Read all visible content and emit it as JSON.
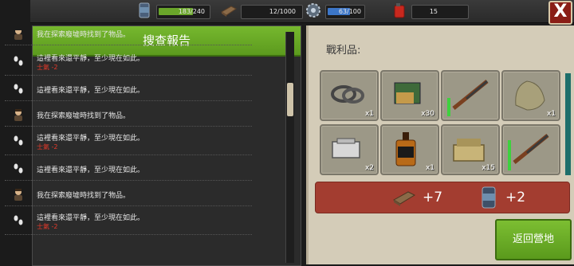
{
  "top_bar": {
    "food": {
      "text": "183/240",
      "fill": 0.76,
      "color": "#6aa62a",
      "icon": "canned-food-icon"
    },
    "materials": {
      "text": "12/1000",
      "icon": "wood-plank-icon"
    },
    "water": {
      "text": "63/100",
      "fill": 0.63,
      "color": "#3c76c8",
      "icon": "water-gear-icon"
    },
    "fuel": {
      "text": "15",
      "icon": "fuel-can-icon"
    },
    "close_label": "X"
  },
  "report": {
    "title": "搜查報告",
    "entries": [
      {
        "icon": "survivor-icon",
        "text": "我在探索廢墟時找到了物品。",
        "morale": ""
      },
      {
        "icon": "footprints-icon",
        "text": "這裡看來還平靜，至少現在如此。",
        "morale": "士氣 -2"
      },
      {
        "icon": "footprints-icon",
        "text": "這裡看來還平靜，至少現在如此。",
        "morale": ""
      },
      {
        "icon": "survivor-icon",
        "text": "我在探索廢墟時找到了物品。",
        "morale": ""
      },
      {
        "icon": "footprints-icon",
        "text": "這裡看來還平靜，至少現在如此。",
        "morale": "士氣 -2"
      },
      {
        "icon": "footprints-icon",
        "text": "這裡看來還平靜，至少現在如此。",
        "morale": ""
      },
      {
        "icon": "survivor-icon",
        "text": "我在探索廢墟時找到了物品。",
        "morale": ""
      },
      {
        "icon": "footprints-icon",
        "text": "這裡看來還平靜，至少現在如此。",
        "morale": "士氣 -2"
      }
    ]
  },
  "loot": {
    "title": "戰利品:",
    "items": [
      {
        "icon": "rope-icon",
        "qty": "x1",
        "condition": null
      },
      {
        "icon": "ammo-box-icon",
        "qty": "x30",
        "condition": null
      },
      {
        "icon": "rifle-icon",
        "qty": "",
        "condition": 0.45
      },
      {
        "icon": "cloth-sack-icon",
        "qty": "x1",
        "condition": null
      },
      {
        "icon": "toolbox-icon",
        "qty": "x2",
        "condition": null
      },
      {
        "icon": "whiskey-bottle-icon",
        "qty": "x1",
        "condition": null
      },
      {
        "icon": "bullets-crate-icon",
        "qty": "x15",
        "condition": null
      },
      {
        "icon": "rifle-icon",
        "qty": "",
        "condition": 0.75
      }
    ],
    "gains": [
      {
        "icon": "wood-plank-icon",
        "value": "+7"
      },
      {
        "icon": "canned-food-icon",
        "value": "+2"
      }
    ]
  },
  "return_button": "返回營地"
}
